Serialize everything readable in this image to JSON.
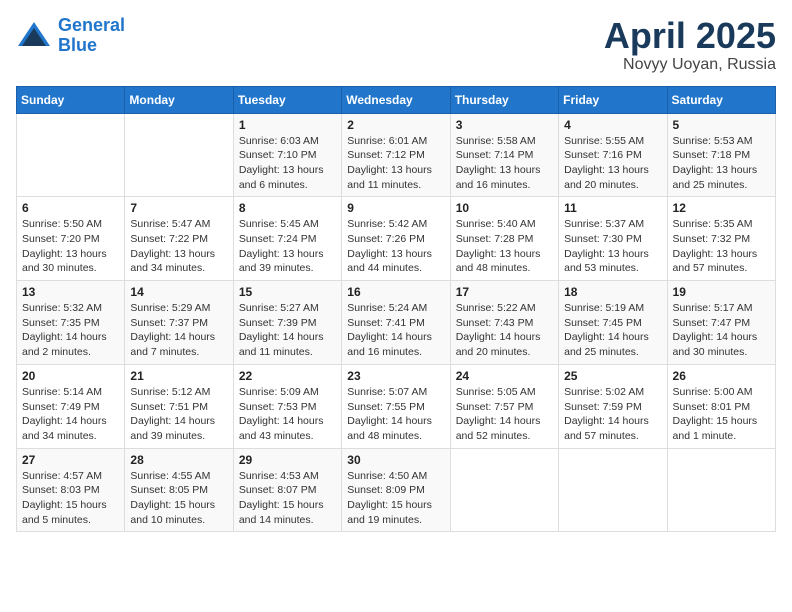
{
  "logo": {
    "line1": "General",
    "line2": "Blue"
  },
  "title": "April 2025",
  "subtitle": "Novyy Uoyan, Russia",
  "weekdays": [
    "Sunday",
    "Monday",
    "Tuesday",
    "Wednesday",
    "Thursday",
    "Friday",
    "Saturday"
  ],
  "weeks": [
    [
      {
        "day": "",
        "info": ""
      },
      {
        "day": "",
        "info": ""
      },
      {
        "day": "1",
        "info": "Sunrise: 6:03 AM\nSunset: 7:10 PM\nDaylight: 13 hours and 6 minutes."
      },
      {
        "day": "2",
        "info": "Sunrise: 6:01 AM\nSunset: 7:12 PM\nDaylight: 13 hours and 11 minutes."
      },
      {
        "day": "3",
        "info": "Sunrise: 5:58 AM\nSunset: 7:14 PM\nDaylight: 13 hours and 16 minutes."
      },
      {
        "day": "4",
        "info": "Sunrise: 5:55 AM\nSunset: 7:16 PM\nDaylight: 13 hours and 20 minutes."
      },
      {
        "day": "5",
        "info": "Sunrise: 5:53 AM\nSunset: 7:18 PM\nDaylight: 13 hours and 25 minutes."
      }
    ],
    [
      {
        "day": "6",
        "info": "Sunrise: 5:50 AM\nSunset: 7:20 PM\nDaylight: 13 hours and 30 minutes."
      },
      {
        "day": "7",
        "info": "Sunrise: 5:47 AM\nSunset: 7:22 PM\nDaylight: 13 hours and 34 minutes."
      },
      {
        "day": "8",
        "info": "Sunrise: 5:45 AM\nSunset: 7:24 PM\nDaylight: 13 hours and 39 minutes."
      },
      {
        "day": "9",
        "info": "Sunrise: 5:42 AM\nSunset: 7:26 PM\nDaylight: 13 hours and 44 minutes."
      },
      {
        "day": "10",
        "info": "Sunrise: 5:40 AM\nSunset: 7:28 PM\nDaylight: 13 hours and 48 minutes."
      },
      {
        "day": "11",
        "info": "Sunrise: 5:37 AM\nSunset: 7:30 PM\nDaylight: 13 hours and 53 minutes."
      },
      {
        "day": "12",
        "info": "Sunrise: 5:35 AM\nSunset: 7:32 PM\nDaylight: 13 hours and 57 minutes."
      }
    ],
    [
      {
        "day": "13",
        "info": "Sunrise: 5:32 AM\nSunset: 7:35 PM\nDaylight: 14 hours and 2 minutes."
      },
      {
        "day": "14",
        "info": "Sunrise: 5:29 AM\nSunset: 7:37 PM\nDaylight: 14 hours and 7 minutes."
      },
      {
        "day": "15",
        "info": "Sunrise: 5:27 AM\nSunset: 7:39 PM\nDaylight: 14 hours and 11 minutes."
      },
      {
        "day": "16",
        "info": "Sunrise: 5:24 AM\nSunset: 7:41 PM\nDaylight: 14 hours and 16 minutes."
      },
      {
        "day": "17",
        "info": "Sunrise: 5:22 AM\nSunset: 7:43 PM\nDaylight: 14 hours and 20 minutes."
      },
      {
        "day": "18",
        "info": "Sunrise: 5:19 AM\nSunset: 7:45 PM\nDaylight: 14 hours and 25 minutes."
      },
      {
        "day": "19",
        "info": "Sunrise: 5:17 AM\nSunset: 7:47 PM\nDaylight: 14 hours and 30 minutes."
      }
    ],
    [
      {
        "day": "20",
        "info": "Sunrise: 5:14 AM\nSunset: 7:49 PM\nDaylight: 14 hours and 34 minutes."
      },
      {
        "day": "21",
        "info": "Sunrise: 5:12 AM\nSunset: 7:51 PM\nDaylight: 14 hours and 39 minutes."
      },
      {
        "day": "22",
        "info": "Sunrise: 5:09 AM\nSunset: 7:53 PM\nDaylight: 14 hours and 43 minutes."
      },
      {
        "day": "23",
        "info": "Sunrise: 5:07 AM\nSunset: 7:55 PM\nDaylight: 14 hours and 48 minutes."
      },
      {
        "day": "24",
        "info": "Sunrise: 5:05 AM\nSunset: 7:57 PM\nDaylight: 14 hours and 52 minutes."
      },
      {
        "day": "25",
        "info": "Sunrise: 5:02 AM\nSunset: 7:59 PM\nDaylight: 14 hours and 57 minutes."
      },
      {
        "day": "26",
        "info": "Sunrise: 5:00 AM\nSunset: 8:01 PM\nDaylight: 15 hours and 1 minute."
      }
    ],
    [
      {
        "day": "27",
        "info": "Sunrise: 4:57 AM\nSunset: 8:03 PM\nDaylight: 15 hours and 5 minutes."
      },
      {
        "day": "28",
        "info": "Sunrise: 4:55 AM\nSunset: 8:05 PM\nDaylight: 15 hours and 10 minutes."
      },
      {
        "day": "29",
        "info": "Sunrise: 4:53 AM\nSunset: 8:07 PM\nDaylight: 15 hours and 14 minutes."
      },
      {
        "day": "30",
        "info": "Sunrise: 4:50 AM\nSunset: 8:09 PM\nDaylight: 15 hours and 19 minutes."
      },
      {
        "day": "",
        "info": ""
      },
      {
        "day": "",
        "info": ""
      },
      {
        "day": "",
        "info": ""
      }
    ]
  ]
}
